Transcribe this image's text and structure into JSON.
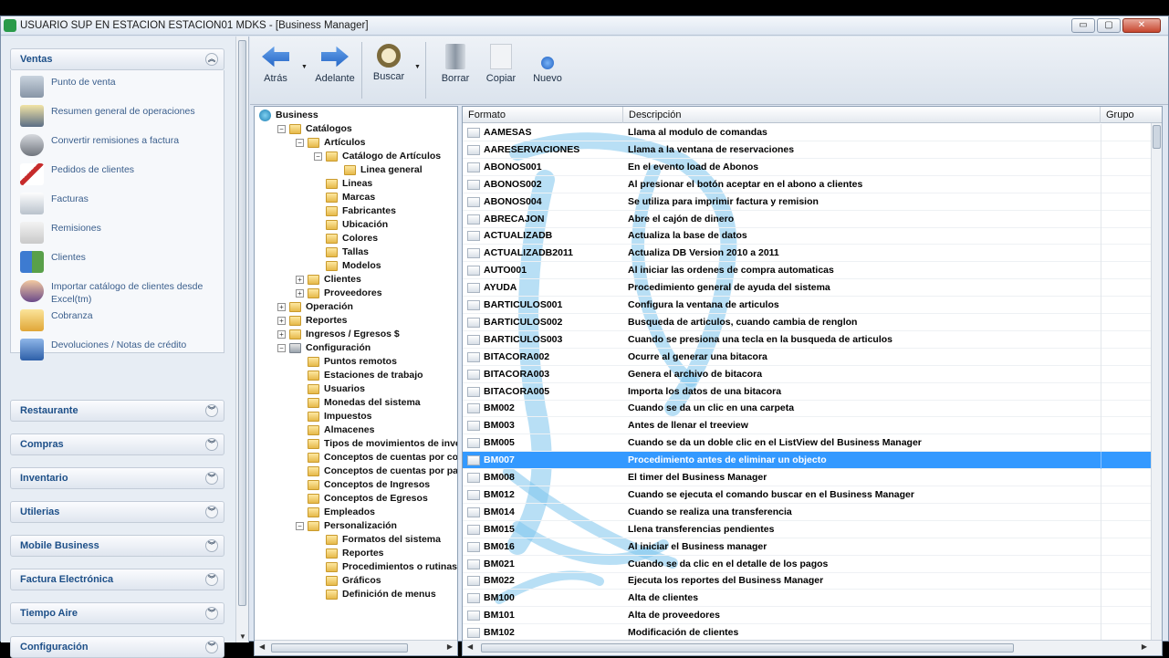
{
  "window": {
    "title": "USUARIO SUP EN ESTACION ESTACION01    MDKS - [Business Manager]",
    "buttons": [
      "▭",
      "▢",
      "✕"
    ]
  },
  "sidebar": {
    "open_group": "Ventas",
    "items": [
      {
        "label": "Punto de venta",
        "icon": "cash-register-icon"
      },
      {
        "label": "Resumen general de operaciones",
        "icon": "report-icon"
      },
      {
        "label": "Convertir remisiones a factura",
        "icon": "convert-icon"
      },
      {
        "label": "Pedidos de clientes",
        "icon": "order-icon"
      },
      {
        "label": "Facturas",
        "icon": "invoice-icon"
      },
      {
        "label": "Remisiones",
        "icon": "delivery-note-icon"
      },
      {
        "label": "Clientes",
        "icon": "clients-icon"
      },
      {
        "label": "Importar catálogo de clientes desde Excel(tm)",
        "icon": "import-icon"
      },
      {
        "label": "Cobranza",
        "icon": "payments-icon"
      },
      {
        "label": "Devoluciones / Notas de crédito",
        "icon": "returns-icon"
      }
    ],
    "groups": [
      "Restaurante",
      "Compras",
      "Inventario",
      "Utilerias",
      "Mobile Business",
      "Factura Electrónica",
      "Tiempo Aire",
      "Configuración"
    ]
  },
  "toolbar": {
    "back": "Atrás",
    "forward": "Adelante",
    "search": "Buscar",
    "delete": "Borrar",
    "copy": "Copiar",
    "new": "Nuevo"
  },
  "tree": {
    "nodes": [
      {
        "label": "Business",
        "level": 0,
        "exp": "",
        "icon": "globe"
      },
      {
        "label": "Catálogos",
        "level": 1,
        "exp": "−",
        "icon": "folder"
      },
      {
        "label": "Artículos",
        "level": 2,
        "exp": "−",
        "icon": "folder"
      },
      {
        "label": "Catálogo de Artículos",
        "level": 3,
        "exp": "−",
        "icon": "folder"
      },
      {
        "label": "Linea general",
        "level": 4,
        "exp": "",
        "icon": "folder"
      },
      {
        "label": "Lineas",
        "level": 3,
        "exp": "",
        "icon": "folder"
      },
      {
        "label": "Marcas",
        "level": 3,
        "exp": "",
        "icon": "folder"
      },
      {
        "label": "Fabricantes",
        "level": 3,
        "exp": "",
        "icon": "folder"
      },
      {
        "label": "Ubicación",
        "level": 3,
        "exp": "",
        "icon": "folder"
      },
      {
        "label": "Colores",
        "level": 3,
        "exp": "",
        "icon": "folder"
      },
      {
        "label": "Tallas",
        "level": 3,
        "exp": "",
        "icon": "folder"
      },
      {
        "label": "Modelos",
        "level": 3,
        "exp": "",
        "icon": "folder"
      },
      {
        "label": "Clientes",
        "level": 2,
        "exp": "+",
        "icon": "folder"
      },
      {
        "label": "Proveedores",
        "level": 2,
        "exp": "+",
        "icon": "folder"
      },
      {
        "label": "Operación",
        "level": 1,
        "exp": "+",
        "icon": "folder"
      },
      {
        "label": "Reportes",
        "level": 1,
        "exp": "+",
        "icon": "folder"
      },
      {
        "label": "Ingresos / Egresos $",
        "level": 1,
        "exp": "+",
        "icon": "folder"
      },
      {
        "label": "Configuración",
        "level": 1,
        "exp": "−",
        "icon": "wrench"
      },
      {
        "label": "Puntos remotos",
        "level": 2,
        "exp": "",
        "icon": "folder"
      },
      {
        "label": "Estaciones de trabajo",
        "level": 2,
        "exp": "",
        "icon": "folder"
      },
      {
        "label": "Usuarios",
        "level": 2,
        "exp": "",
        "icon": "folder"
      },
      {
        "label": "Monedas del sistema",
        "level": 2,
        "exp": "",
        "icon": "folder"
      },
      {
        "label": "Impuestos",
        "level": 2,
        "exp": "",
        "icon": "folder"
      },
      {
        "label": "Almacenes",
        "level": 2,
        "exp": "",
        "icon": "folder"
      },
      {
        "label": "Tipos de movimientos de inven",
        "level": 2,
        "exp": "",
        "icon": "folder"
      },
      {
        "label": "Conceptos de cuentas por cob",
        "level": 2,
        "exp": "",
        "icon": "folder"
      },
      {
        "label": "Conceptos de cuentas por pag",
        "level": 2,
        "exp": "",
        "icon": "folder"
      },
      {
        "label": "Conceptos de Ingresos",
        "level": 2,
        "exp": "",
        "icon": "folder"
      },
      {
        "label": "Conceptos de Egresos",
        "level": 2,
        "exp": "",
        "icon": "folder"
      },
      {
        "label": "Empleados",
        "level": 2,
        "exp": "",
        "icon": "folder"
      },
      {
        "label": "Personalización",
        "level": 2,
        "exp": "−",
        "icon": "folder"
      },
      {
        "label": "Formatos del sistema",
        "level": 3,
        "exp": "",
        "icon": "folder"
      },
      {
        "label": "Reportes",
        "level": 3,
        "exp": "",
        "icon": "folder"
      },
      {
        "label": "Procedimientos o rutinas d",
        "level": 3,
        "exp": "",
        "icon": "folder"
      },
      {
        "label": "Gráficos",
        "level": 3,
        "exp": "",
        "icon": "folder"
      },
      {
        "label": "Definición de menus",
        "level": 3,
        "exp": "",
        "icon": "folder"
      }
    ]
  },
  "list": {
    "columns": [
      "Formato",
      "Descripción",
      "Grupo"
    ],
    "selected_index": 19,
    "rows": [
      [
        "AAMESAS",
        "Llama al modulo de comandas"
      ],
      [
        "AARESERVACIONES",
        "Llama a la ventana de reservaciones"
      ],
      [
        "ABONOS001",
        "En el evento load de Abonos"
      ],
      [
        "ABONOS002",
        "Al presionar el botón aceptar en el abono a clientes"
      ],
      [
        "ABONOS004",
        "Se utiliza para imprimir factura y remision"
      ],
      [
        "ABRECAJON",
        "Abre el cajón de dinero"
      ],
      [
        "ACTUALIZADB",
        "Actualiza la base de datos"
      ],
      [
        "ACTUALIZADB2011",
        "Actualiza DB Version 2010 a 2011"
      ],
      [
        "AUTO001",
        "Al iniciar las ordenes de compra automaticas"
      ],
      [
        "AYUDA",
        "Procedimiento general de ayuda del sistema"
      ],
      [
        "BARTICULOS001",
        "Configura la ventana de articulos"
      ],
      [
        "BARTICULOS002",
        "Busqueda de articulos, cuando cambia de renglon"
      ],
      [
        "BARTICULOS003",
        "Cuando se presiona una tecla en la busqueda de articulos"
      ],
      [
        "BITACORA002",
        "Ocurre al generar una bitacora"
      ],
      [
        "BITACORA003",
        "Genera el archivo de bitacora"
      ],
      [
        "BITACORA005",
        "Importa los datos de una bitacora"
      ],
      [
        "BM002",
        "Cuando se da un clic en una carpeta"
      ],
      [
        "BM003",
        "Antes de llenar el treeview"
      ],
      [
        "BM005",
        "Cuando se da un doble clic en el ListView del Business Manager"
      ],
      [
        "BM007",
        "Procedimiento antes de eliminar un objecto"
      ],
      [
        "BM008",
        "El timer del Business Manager"
      ],
      [
        "BM012",
        "Cuando se ejecuta el comando buscar en el Business Manager"
      ],
      [
        "BM014",
        "Cuando se realiza una transferencia"
      ],
      [
        "BM015",
        "Llena transferencias pendientes"
      ],
      [
        "BM016",
        "Al iniciar el Business manager"
      ],
      [
        "BM021",
        "Cuando se da clic en el detalle de los pagos"
      ],
      [
        "BM022",
        "Ejecuta los reportes del Business Manager"
      ],
      [
        "BM100",
        "Alta de clientes"
      ],
      [
        "BM101",
        "Alta de proveedores"
      ],
      [
        "BM102",
        "Modificación de clientes"
      ]
    ]
  },
  "colors": {
    "selection": "#3399ff",
    "header_text": "#1d4f88",
    "watermark": "#7ec4ec"
  }
}
